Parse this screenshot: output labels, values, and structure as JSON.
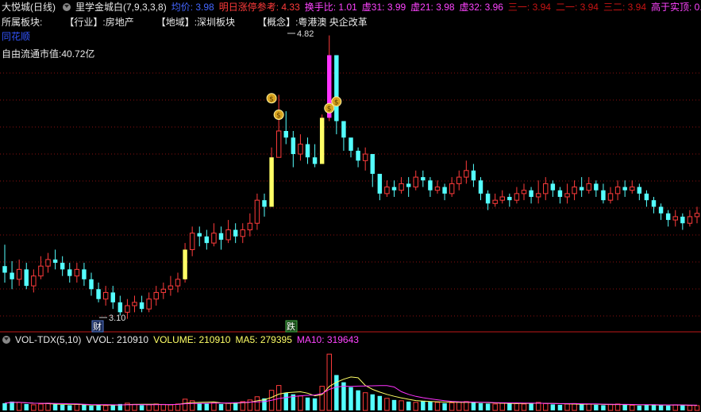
{
  "header": {
    "stock_name": "大悦城(日线)",
    "indicator_name": "里学金城白(7,9,3,3,8)",
    "avg_price_label": "均价: 3.98",
    "limit_ref_label": "明日涨停参考: 4.33",
    "turnover_label": "换手比: 1.01",
    "v31_label": "虚31: 3.99",
    "v21_label": "虚21: 3.98",
    "v32_label": "虚32: 3.96",
    "s1_label": "三一: 3.94",
    "e1_label": "二一: 3.94",
    "s2_label": "三二: 3.94",
    "above_label": "高于实顶: 0.00"
  },
  "info": {
    "sector_label": "所属板块:",
    "industry_tag": "【行业】:",
    "industry_value": "房地产",
    "region_tag": "【地域】:",
    "region_value": "深圳板块",
    "concept_tag": "【概念】:",
    "concept_value": "粤港澳 央企改革",
    "brand": "同花顺",
    "float_cap_label": "自由流通市值:",
    "float_cap_value": "40.72亿"
  },
  "markers": {
    "high_label": "4.82",
    "low_label": "3.10",
    "cai_label": "财",
    "die_label": "跌"
  },
  "volume_header": {
    "name": "VOL-TDX(5,10)",
    "vvol": "VVOL: 210910",
    "volume": "VOLUME: 210910",
    "ma5": "MA5: 279395",
    "ma10": "MA10: 319643"
  },
  "colors": {
    "up": "#ff3b3b",
    "down": "#54ffff",
    "yellow_candle": "#ffff66",
    "magenta_candle": "#ff33ff",
    "ma5": "#ffff66",
    "ma10": "#ff33ff",
    "grid": "#8a1010",
    "divider": "#c01818"
  },
  "chart_data": {
    "type": "candlestick",
    "price_range": [
      3.05,
      4.9
    ],
    "high": 4.82,
    "low": 3.1,
    "candles": [
      [
        3.42,
        3.38,
        3.55,
        3.32
      ],
      [
        3.38,
        3.34,
        3.45,
        3.28
      ],
      [
        3.34,
        3.4,
        3.46,
        3.3
      ],
      [
        3.4,
        3.3,
        3.44,
        3.28
      ],
      [
        3.3,
        3.36,
        3.4,
        3.26
      ],
      [
        3.36,
        3.42,
        3.48,
        3.34
      ],
      [
        3.42,
        3.46,
        3.5,
        3.38
      ],
      [
        3.46,
        3.44,
        3.52,
        3.4
      ],
      [
        3.44,
        3.4,
        3.48,
        3.36
      ],
      [
        3.4,
        3.36,
        3.44,
        3.32
      ],
      [
        3.36,
        3.4,
        3.44,
        3.32
      ],
      [
        3.4,
        3.34,
        3.44,
        3.3
      ],
      [
        3.34,
        3.28,
        3.38,
        3.24
      ],
      [
        3.28,
        3.22,
        3.32,
        3.2
      ],
      [
        3.22,
        3.26,
        3.3,
        3.18
      ],
      [
        3.26,
        3.2,
        3.3,
        3.16
      ],
      [
        3.2,
        3.14,
        3.24,
        3.12
      ],
      [
        3.14,
        3.18,
        3.22,
        3.1
      ],
      [
        3.18,
        3.2,
        3.24,
        3.14
      ],
      [
        3.2,
        3.16,
        3.24,
        3.14
      ],
      [
        3.16,
        3.22,
        3.26,
        3.14
      ],
      [
        3.22,
        3.26,
        3.3,
        3.18
      ],
      [
        3.26,
        3.28,
        3.32,
        3.22
      ],
      [
        3.28,
        3.3,
        3.36,
        3.24
      ],
      [
        3.3,
        3.34,
        3.38,
        3.26
      ],
      [
        3.34,
        3.52,
        3.56,
        3.32
      ],
      [
        3.52,
        3.62,
        3.66,
        3.48
      ],
      [
        3.62,
        3.6,
        3.66,
        3.54
      ],
      [
        3.6,
        3.56,
        3.64,
        3.52
      ],
      [
        3.56,
        3.62,
        3.68,
        3.54
      ],
      [
        3.62,
        3.58,
        3.66,
        3.52
      ],
      [
        3.58,
        3.64,
        3.7,
        3.56
      ],
      [
        3.64,
        3.6,
        3.68,
        3.56
      ],
      [
        3.6,
        3.64,
        3.68,
        3.56
      ],
      [
        3.64,
        3.68,
        3.74,
        3.6
      ],
      [
        3.68,
        3.82,
        3.86,
        3.64
      ],
      [
        3.82,
        3.78,
        3.86,
        3.72
      ],
      [
        3.78,
        4.08,
        4.14,
        3.86
      ],
      [
        4.08,
        4.24,
        4.46,
        4.2
      ],
      [
        4.24,
        4.2,
        4.36,
        4.16
      ],
      [
        4.2,
        4.1,
        4.24,
        4.02
      ],
      [
        4.1,
        4.16,
        4.22,
        4.06
      ],
      [
        4.16,
        4.08,
        4.2,
        4.04
      ],
      [
        4.08,
        4.04,
        4.16,
        4.02
      ],
      [
        4.04,
        4.32,
        4.34,
        4.06
      ],
      [
        4.32,
        4.7,
        4.82,
        4.3
      ],
      [
        4.7,
        4.3,
        4.46,
        4.22
      ],
      [
        4.3,
        4.2,
        4.26,
        4.12
      ],
      [
        4.2,
        4.12,
        4.18,
        4.08
      ],
      [
        4.12,
        4.06,
        4.14,
        4.02
      ],
      [
        4.06,
        4.1,
        4.14,
        4.0
      ],
      [
        4.1,
        3.98,
        4.06,
        3.9
      ],
      [
        3.98,
        3.86,
        3.96,
        3.82
      ],
      [
        3.86,
        3.9,
        3.94,
        3.84
      ],
      [
        3.9,
        3.88,
        3.94,
        3.84
      ],
      [
        3.88,
        3.92,
        3.96,
        3.86
      ],
      [
        3.92,
        3.9,
        3.96,
        3.84
      ],
      [
        3.9,
        3.96,
        4.0,
        3.88
      ],
      [
        3.96,
        3.94,
        4.0,
        3.9
      ],
      [
        3.94,
        3.88,
        3.96,
        3.84
      ],
      [
        3.88,
        3.9,
        3.94,
        3.86
      ],
      [
        3.9,
        3.86,
        3.92,
        3.82
      ],
      [
        3.86,
        3.92,
        3.96,
        3.84
      ],
      [
        3.92,
        3.96,
        4.0,
        3.88
      ],
      [
        3.96,
        4.0,
        4.06,
        3.92
      ],
      [
        4.0,
        3.94,
        4.04,
        3.9
      ],
      [
        3.94,
        3.86,
        3.96,
        3.82
      ],
      [
        3.86,
        3.8,
        3.88,
        3.76
      ],
      [
        3.8,
        3.82,
        3.86,
        3.78
      ],
      [
        3.82,
        3.84,
        3.88,
        3.8
      ],
      [
        3.84,
        3.82,
        3.86,
        3.78
      ],
      [
        3.82,
        3.86,
        3.9,
        3.8
      ],
      [
        3.86,
        3.88,
        3.92,
        3.82
      ],
      [
        3.88,
        3.84,
        3.9,
        3.8
      ],
      [
        3.84,
        3.86,
        3.94,
        3.8
      ],
      [
        3.86,
        3.92,
        3.96,
        3.82
      ],
      [
        3.92,
        3.88,
        3.94,
        3.84
      ],
      [
        3.88,
        3.84,
        3.9,
        3.8
      ],
      [
        3.84,
        3.86,
        3.92,
        3.8
      ],
      [
        3.86,
        3.9,
        3.94,
        3.82
      ],
      [
        3.9,
        3.88,
        3.96,
        3.84
      ],
      [
        3.88,
        3.92,
        3.96,
        3.86
      ],
      [
        3.92,
        3.88,
        3.94,
        3.84
      ],
      [
        3.88,
        3.82,
        3.92,
        3.8
      ],
      [
        3.82,
        3.86,
        3.9,
        3.8
      ],
      [
        3.86,
        3.9,
        3.94,
        3.82
      ],
      [
        3.9,
        3.88,
        3.94,
        3.84
      ],
      [
        3.88,
        3.9,
        3.94,
        3.86
      ],
      [
        3.9,
        3.86,
        3.92,
        3.82
      ],
      [
        3.86,
        3.82,
        3.88,
        3.78
      ],
      [
        3.82,
        3.78,
        3.84,
        3.74
      ],
      [
        3.78,
        3.74,
        3.8,
        3.7
      ],
      [
        3.74,
        3.7,
        3.76,
        3.66
      ],
      [
        3.7,
        3.72,
        3.76,
        3.66
      ],
      [
        3.72,
        3.68,
        3.74,
        3.64
      ],
      [
        3.68,
        3.72,
        3.76,
        3.66
      ],
      [
        3.72,
        3.74,
        3.78,
        3.68
      ]
    ],
    "special_candles": {
      "yellow": [
        25,
        37,
        44
      ],
      "magenta": [
        45
      ]
    },
    "volume": [
      18,
      22,
      20,
      16,
      14,
      16,
      18,
      15,
      14,
      13,
      15,
      14,
      12,
      13,
      12,
      14,
      16,
      18,
      15,
      13,
      14,
      16,
      15,
      14,
      16,
      28,
      24,
      18,
      17,
      19,
      16,
      18,
      20,
      22,
      26,
      34,
      30,
      50,
      62,
      44,
      40,
      36,
      32,
      30,
      60,
      140,
      88,
      70,
      58,
      50,
      44,
      40,
      36,
      30,
      26,
      24,
      22,
      20,
      24,
      22,
      20,
      18,
      19,
      21,
      22,
      20,
      18,
      17,
      16,
      18,
      19,
      17,
      16,
      18,
      20,
      17,
      15,
      14,
      16,
      17,
      15,
      16,
      14,
      13,
      15,
      16,
      14,
      13,
      12,
      14,
      15,
      13,
      12,
      14,
      13,
      12,
      12
    ],
    "volume_max": 160
  }
}
